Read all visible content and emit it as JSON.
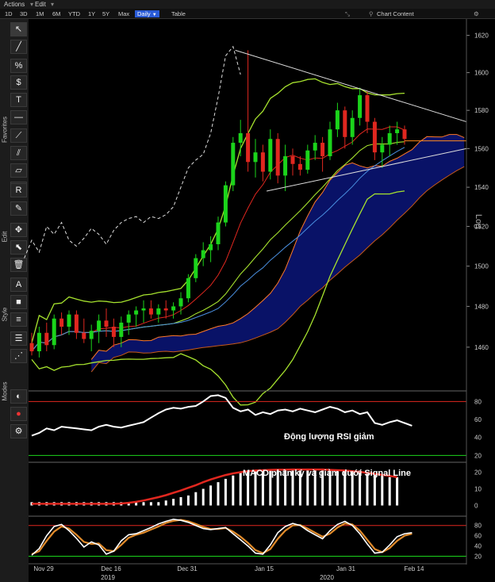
{
  "menu": {
    "actions": "Actions",
    "edit": "Edit"
  },
  "periods": [
    "1D",
    "3D",
    "1M",
    "6M",
    "YTD",
    "1Y",
    "5Y",
    "Max"
  ],
  "selected_period": "Daily",
  "table_label": "Table",
  "chart_content_label": "Chart Content",
  "side_tabs": {
    "favorites": "Favorites",
    "edit": "Edit",
    "style": "Style",
    "modes": "Modes"
  },
  "tools": [
    "pointer-icon",
    "line-icon",
    "percent-line-icon",
    "dollar-line-icon",
    "text-icon",
    "horizontal-line-icon",
    "trend-icon",
    "channel-icon",
    "parallel-icon",
    "ray-icon",
    "r-icon",
    "pen-icon",
    "move-icon",
    "select-icon",
    "delete-icon",
    "font-icon",
    "fill-icon",
    "lines-icon",
    "list-icon",
    "pattern-icon",
    "modes-icon",
    "palette-icon",
    "settings-icon"
  ],
  "colors": {
    "up": "#1bd41b",
    "down": "#e0271f",
    "cloud": "#0a1472",
    "price_line": "#ff8a1e"
  },
  "chart_data": [
    {
      "type": "line",
      "title": "",
      "scale": "Log",
      "ylim": [
        1440,
        1628
      ],
      "y_ticks": [
        1460,
        1480,
        1500,
        1520,
        1540,
        1560,
        1580,
        1600,
        1620
      ],
      "x_ticks": [
        "Nov 29",
        "Dec 16",
        "Dec 31",
        "Jan 15",
        "Jan 31",
        "Feb 14"
      ],
      "x_years": [
        "2019",
        "2020"
      ],
      "candles": [
        [
          1462,
          1467,
          1456,
          1458
        ],
        [
          1458,
          1470,
          1455,
          1467
        ],
        [
          1467,
          1472,
          1458,
          1461
        ],
        [
          1461,
          1476,
          1459,
          1474
        ],
        [
          1474,
          1477,
          1466,
          1470
        ],
        [
          1470,
          1478,
          1466,
          1476
        ],
        [
          1476,
          1478,
          1464,
          1467
        ],
        [
          1467,
          1474,
          1462,
          1464
        ],
        [
          1464,
          1471,
          1458,
          1468
        ],
        [
          1468,
          1476,
          1462,
          1473
        ],
        [
          1473,
          1479,
          1465,
          1470
        ],
        [
          1470,
          1474,
          1460,
          1465
        ],
        [
          1465,
          1475,
          1460,
          1472
        ],
        [
          1472,
          1478,
          1466,
          1476
        ],
        [
          1476,
          1480,
          1470,
          1478
        ],
        [
          1478,
          1483,
          1472,
          1479
        ],
        [
          1479,
          1483,
          1474,
          1476
        ],
        [
          1476,
          1481,
          1472,
          1479
        ],
        [
          1479,
          1483,
          1474,
          1478
        ],
        [
          1478,
          1482,
          1474,
          1480
        ],
        [
          1480,
          1487,
          1476,
          1484
        ],
        [
          1484,
          1496,
          1482,
          1494
        ],
        [
          1494,
          1506,
          1492,
          1504
        ],
        [
          1504,
          1512,
          1500,
          1508
        ],
        [
          1508,
          1515,
          1502,
          1511
        ],
        [
          1511,
          1525,
          1508,
          1522
        ],
        [
          1522,
          1543,
          1520,
          1541
        ],
        [
          1541,
          1566,
          1538,
          1563
        ],
        [
          1563,
          1575,
          1556,
          1568
        ],
        [
          1568,
          1612,
          1548,
          1553
        ],
        [
          1553,
          1565,
          1545,
          1558
        ],
        [
          1558,
          1562,
          1543,
          1548
        ],
        [
          1548,
          1570,
          1544,
          1565
        ],
        [
          1565,
          1568,
          1542,
          1546
        ],
        [
          1546,
          1562,
          1538,
          1556
        ],
        [
          1556,
          1560,
          1546,
          1552
        ],
        [
          1552,
          1556,
          1546,
          1549
        ],
        [
          1549,
          1562,
          1547,
          1559
        ],
        [
          1559,
          1567,
          1554,
          1563
        ],
        [
          1563,
          1566,
          1548,
          1556
        ],
        [
          1556,
          1574,
          1554,
          1570
        ],
        [
          1570,
          1584,
          1566,
          1580
        ],
        [
          1580,
          1582,
          1560,
          1566
        ],
        [
          1566,
          1580,
          1562,
          1576
        ],
        [
          1576,
          1592,
          1572,
          1588
        ],
        [
          1588,
          1590,
          1568,
          1574
        ],
        [
          1574,
          1576,
          1554,
          1558
        ],
        [
          1558,
          1566,
          1550,
          1562
        ],
        [
          1562,
          1572,
          1556,
          1568
        ],
        [
          1568,
          1574,
          1562,
          1570
        ],
        [
          1570,
          1572,
          1562,
          1565
        ]
      ],
      "last_price": 1564,
      "annotations": []
    },
    {
      "type": "line",
      "title": "",
      "ylim": [
        15,
        90
      ],
      "y_ticks": [
        20,
        40,
        60,
        80
      ],
      "levels": [
        20,
        80
      ],
      "values": [
        42,
        45,
        50,
        48,
        52,
        51,
        50,
        49,
        48,
        52,
        54,
        52,
        51,
        53,
        55,
        57,
        62,
        67,
        71,
        73,
        72,
        74,
        75,
        80,
        86,
        87,
        84,
        73,
        69,
        71,
        65,
        68,
        66,
        70,
        71,
        69,
        72,
        70,
        68,
        71,
        74,
        72,
        68,
        70,
        66,
        68,
        56,
        54,
        57,
        59,
        56,
        53
      ],
      "annotation": "Động lượng RSI giảm"
    },
    {
      "type": "bar",
      "title": "",
      "ylim": [
        -5,
        25
      ],
      "y_ticks": [
        0,
        10,
        20
      ],
      "histogram": [
        2,
        2,
        2,
        2,
        2,
        2,
        2,
        2,
        2,
        2,
        2,
        2,
        2,
        2,
        2,
        2,
        2,
        2,
        3,
        4,
        5,
        6,
        8,
        10,
        12,
        14,
        16,
        18,
        20,
        21,
        21,
        21,
        21,
        21,
        21,
        21,
        21,
        21,
        21,
        21,
        21,
        21,
        21,
        21,
        21,
        20,
        19,
        18,
        17,
        17
      ],
      "signal": [
        1,
        1,
        1,
        1,
        1,
        1,
        1,
        1,
        1,
        1,
        1,
        1,
        1.2,
        1.6,
        2.2,
        3,
        4,
        5,
        6.2,
        7.6,
        9,
        10.6,
        12.2,
        14,
        15.6,
        17,
        18.3,
        19.3,
        20,
        20.6,
        21,
        21.2,
        21.4,
        21.5,
        21.5,
        21.6,
        21.6,
        21.6,
        21.6,
        21.6,
        21.4,
        21.2,
        21,
        20.6,
        20.2,
        19.6,
        19,
        18.4,
        17.8,
        17
      ],
      "annotation": "MACD phân kỳ và giảm dưới Signal Line"
    },
    {
      "type": "line",
      "title": "",
      "ylim": [
        10,
        95
      ],
      "y_ticks": [
        20,
        40,
        60,
        80
      ],
      "levels": [
        20,
        80
      ],
      "k": [
        22,
        35,
        60,
        78,
        82,
        70,
        55,
        38,
        48,
        42,
        24,
        30,
        50,
        62,
        64,
        70,
        76,
        83,
        88,
        92,
        90,
        86,
        80,
        74,
        72,
        74,
        76,
        64,
        52,
        40,
        26,
        24,
        42,
        66,
        78,
        84,
        80,
        70,
        62,
        54,
        70,
        82,
        88,
        80,
        64,
        44,
        26,
        28,
        42,
        58,
        64,
        66
      ],
      "d": [
        24,
        30,
        50,
        68,
        78,
        74,
        62,
        48,
        44,
        45,
        32,
        30,
        42,
        56,
        62,
        66,
        72,
        78,
        85,
        89,
        91,
        88,
        83,
        77,
        73,
        73,
        75,
        68,
        58,
        46,
        32,
        26,
        34,
        54,
        70,
        80,
        81,
        74,
        66,
        58,
        64,
        76,
        84,
        82,
        70,
        52,
        34,
        28,
        36,
        50,
        60,
        64
      ]
    }
  ]
}
